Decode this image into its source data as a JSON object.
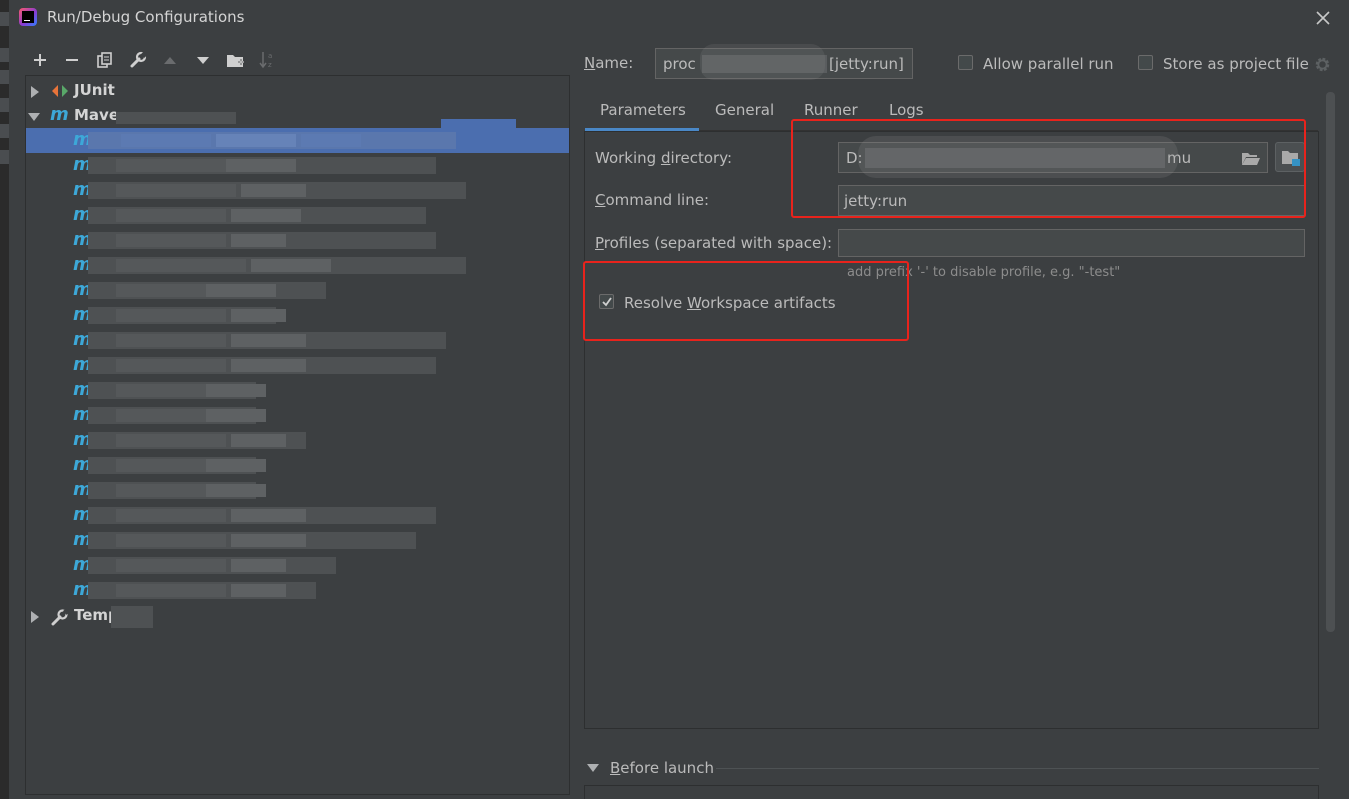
{
  "window": {
    "title": "Run/Debug Configurations"
  },
  "toolbar": {
    "add": "+",
    "remove": "−",
    "copy_icon": "copy-icon",
    "edit_icon": "wrench-icon",
    "up_icon": "arrow-up-icon",
    "down_icon": "arrow-down-icon",
    "folder_icon": "new-folder-icon",
    "sort_icon": "sort-icon"
  },
  "tree": {
    "nodes": [
      {
        "label": "JUnit",
        "expanded": false
      },
      {
        "label": "Mave",
        "expanded": true
      },
      {
        "label": "Temp",
        "expanded": false
      }
    ],
    "maven_items": [
      "",
      "",
      "",
      "",
      "",
      "",
      "",
      "",
      "",
      "",
      "",
      "",
      "",
      "",
      "",
      "",
      "",
      "",
      ""
    ],
    "maven_item_initials": [
      "",
      "",
      "",
      "",
      "",
      "",
      "",
      "",
      "",
      "",
      "p",
      "c",
      "i",
      "u",
      "b",
      "b",
      "b",
      "",
      ""
    ]
  },
  "form": {
    "name_label": "Name:",
    "name_value_start": "proc",
    "name_value_end": "[jetty:run]",
    "allow_parallel_label": "Allow parallel run",
    "allow_parallel_checked": false,
    "store_project_label": "Store as project file",
    "store_project_checked": false,
    "tabs": [
      "Parameters",
      "General",
      "Runner",
      "Logs"
    ],
    "active_tab": "Parameters",
    "working_dir_label": "Working directory:",
    "working_dir_start": "D:",
    "working_dir_end": "mu",
    "command_line_label": "Command line:",
    "command_line_value": "jetty:run",
    "profiles_label": "Profiles (separated with space):",
    "profiles_value": "",
    "profiles_hint": "add prefix '-' to disable profile, e.g. \"-test\"",
    "resolve_label": "Resolve Workspace artifacts",
    "resolve_checked": true,
    "before_launch_label": "Before launch"
  },
  "colors": {
    "background": "#3c3f41",
    "selection": "#4b6eaf",
    "accent_tab": "#4a88c7",
    "highlight_box": "#e8231c",
    "maven_icon": "#3da8d8"
  }
}
